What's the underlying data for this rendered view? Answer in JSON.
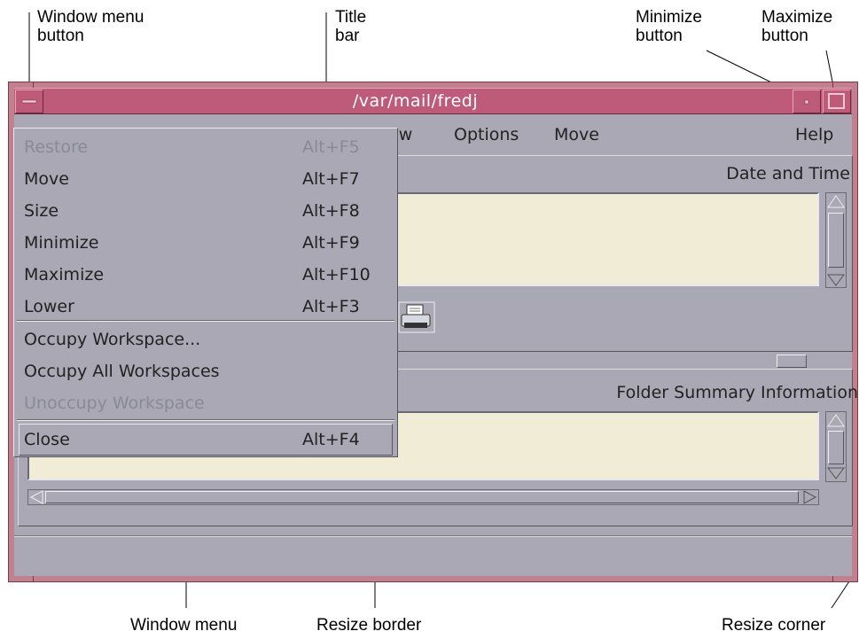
{
  "callouts": {
    "window_menu_button": "Window menu\nbutton",
    "title_bar": "Title\nbar",
    "minimize_button": "Minimize\nbutton",
    "maximize_button": "Maximize\nbutton",
    "window_menu": "Window menu",
    "resize_border": "Resize border",
    "resize_corner": "Resize corner"
  },
  "window": {
    "title": "/var/mail/fredj"
  },
  "menubar": {
    "view_partial": "ew",
    "options": "Options",
    "move": "Move",
    "help": "Help"
  },
  "headers": {
    "top_right": "Date and Time",
    "bottom_right": "Folder Summary Information"
  },
  "window_menu": {
    "items": [
      {
        "label": "Restore",
        "accel": "Alt+F5",
        "enabled": false
      },
      {
        "label": "Move",
        "accel": "Alt+F7",
        "enabled": true
      },
      {
        "label": "Size",
        "accel": "Alt+F8",
        "enabled": true
      },
      {
        "label": "Minimize",
        "accel": "Alt+F9",
        "enabled": true
      },
      {
        "label": "Maximize",
        "accel": "Alt+F10",
        "enabled": true
      },
      {
        "label": "Lower",
        "accel": "Alt+F3",
        "enabled": true
      },
      {
        "label": "Occupy Workspace...",
        "accel": "",
        "enabled": true
      },
      {
        "label": "Occupy All Workspaces",
        "accel": "",
        "enabled": true
      },
      {
        "label": "Unoccupy Workspace",
        "accel": "",
        "enabled": false
      },
      {
        "label": "Close",
        "accel": "Alt+F4",
        "enabled": true,
        "selected": true
      }
    ]
  },
  "icons": {
    "window_menu_button": "dash-icon",
    "minimize_button": "dot-icon",
    "maximize_button": "square-icon",
    "printer": "printer-icon",
    "scroll_arrows": "triangle-arrow-icon"
  },
  "colors": {
    "frame": "#c2808f",
    "titlebar": "#be5a7a",
    "window_bg": "#a9a8b4",
    "list_bg": "#f1ecd6"
  }
}
